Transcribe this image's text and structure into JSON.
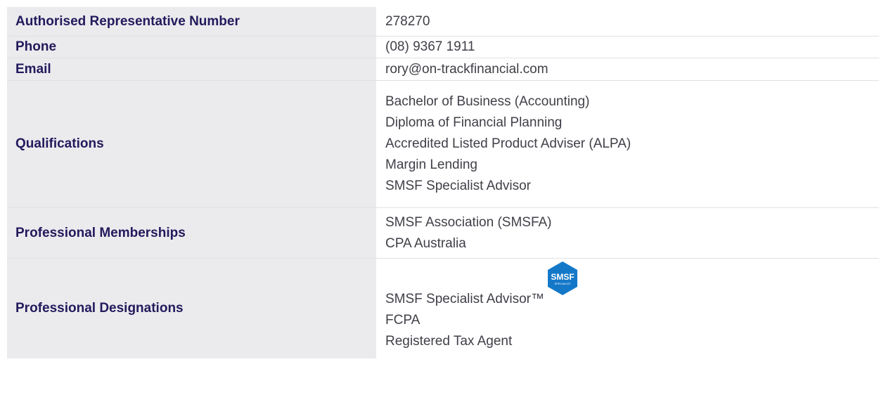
{
  "rows": {
    "authorised_rep": {
      "label": "Authorised Representative Number",
      "value": "278270"
    },
    "phone": {
      "label": "Phone",
      "value": "(08) 9367 1911"
    },
    "email": {
      "label": "Email",
      "value": "rory@on-trackfinancial.com"
    },
    "qualifications": {
      "label": "Qualifications",
      "values": [
        "Bachelor of Business (Accounting)",
        "Diploma of Financial Planning",
        "Accredited Listed Product Adviser (ALPA)",
        "Margin Lending",
        "SMSF Specialist Advisor"
      ]
    },
    "memberships": {
      "label": "Professional Memberships",
      "values": [
        "SMSF Association (SMSFA)",
        "CPA Australia"
      ]
    },
    "designations": {
      "label": "Professional Designations",
      "values": [
        "SMSF Specialist Advisor™",
        "FCPA",
        "Registered Tax Agent"
      ],
      "badge": {
        "icon": "smsf-specialist-badge-icon",
        "title": "SMSF",
        "subtitle": "SPECIALIST",
        "color": "#1478c8"
      }
    }
  },
  "colors": {
    "label_bg": "#ebebee",
    "label_text": "#231a5c",
    "value_text": "#3f3f48",
    "divider": "#e1e1e6"
  }
}
